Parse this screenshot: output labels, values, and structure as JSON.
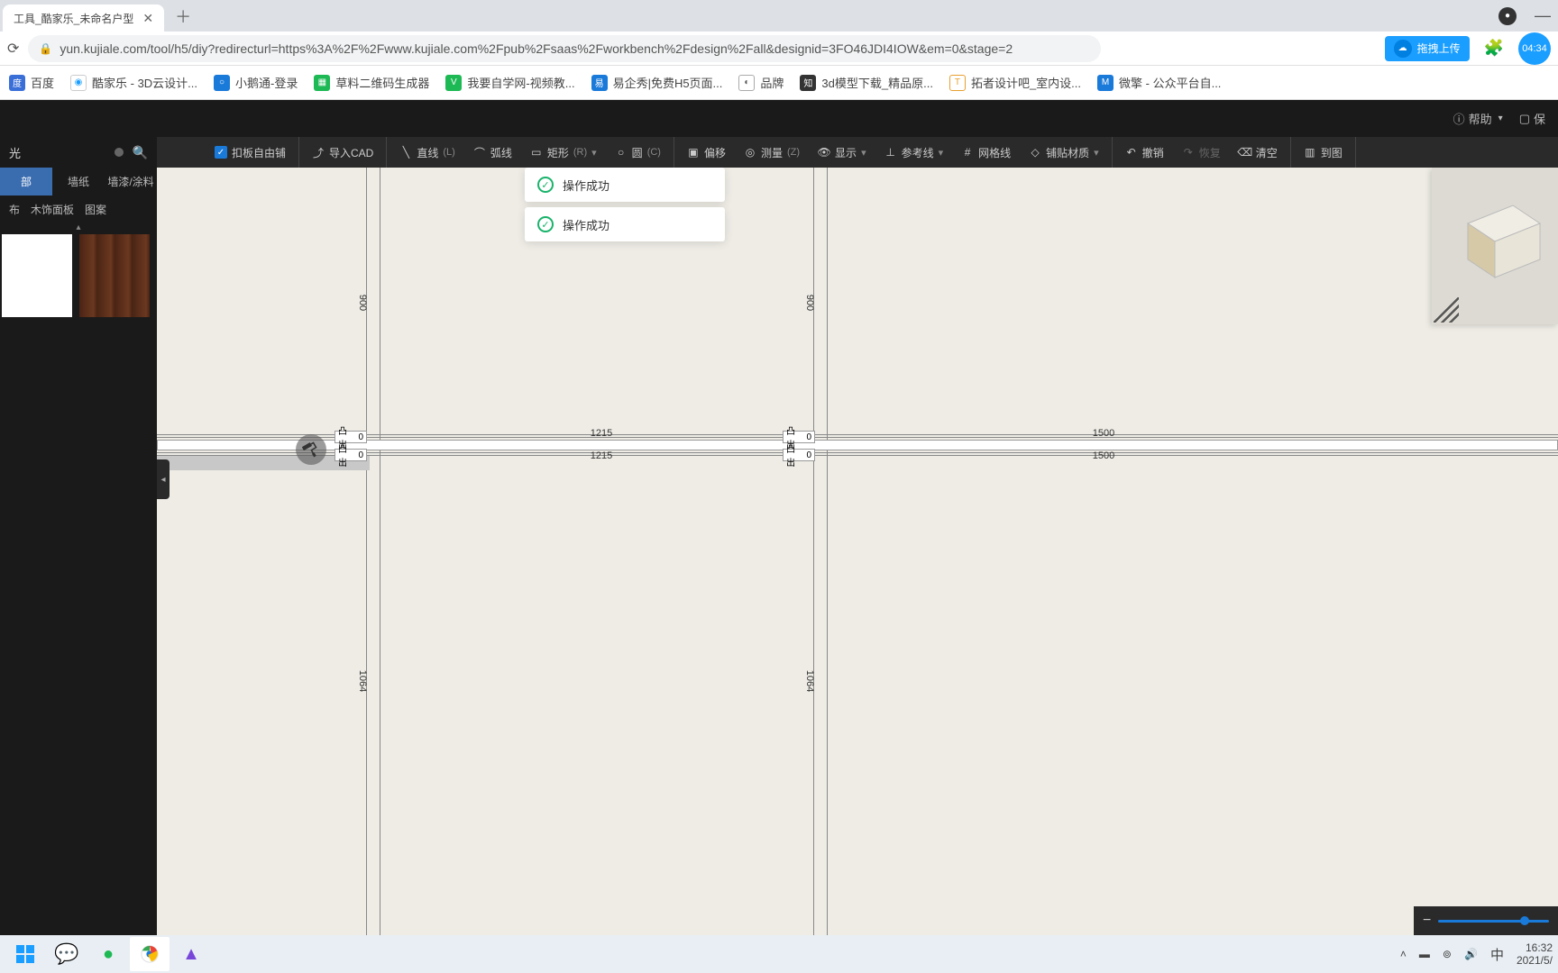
{
  "browser": {
    "tab_title": "工具_酷家乐_未命名户型",
    "url": "yun.kujiale.com/tool/h5/diy?redirecturl=https%3A%2F%2Fwww.kujiale.com%2Fpub%2Fsaas%2Fworkbench%2Fdesign%2Fall&designid=3FO46JDI4IOW&em=0&stage=2",
    "drag_upload": "拖拽上传",
    "timer": "04:34"
  },
  "bookmarks": [
    {
      "label": "百度",
      "color": "#3b6fd8"
    },
    {
      "label": "酷家乐 - 3D云设计...",
      "color": "#fff"
    },
    {
      "label": "小鹅通-登录",
      "color": "#1a7ad9"
    },
    {
      "label": "草料二维码生成器",
      "color": "#1db954"
    },
    {
      "label": "我要自学网-视频教...",
      "color": "#1db954"
    },
    {
      "label": "易企秀|免费H5页面...",
      "color": "#1a7ad9"
    },
    {
      "label": "品牌",
      "color": "#555"
    },
    {
      "label": "3d模型下载_精品原...",
      "color": "#333"
    },
    {
      "label": "拓者设计吧_室内设...",
      "color": "#e8a030"
    },
    {
      "label": "微擎 - 公众平台自...",
      "color": "#1a7ad9"
    }
  ],
  "header": {
    "help": "帮助",
    "save": "保"
  },
  "sidebar": {
    "title": "光",
    "tabs": [
      "部",
      "墙纸",
      "墙漆/涂料"
    ],
    "subs": [
      "布",
      "木饰面板",
      "图案"
    ]
  },
  "toolbar": {
    "snap": "扣板自由铺",
    "import_cad": "导入CAD",
    "line": "直线",
    "line_key": "(L)",
    "arc": "弧线",
    "rect": "矩形",
    "rect_key": "(R)",
    "circle": "圆",
    "circle_key": "(C)",
    "offset": "偏移",
    "measure": "测量",
    "measure_key": "(Z)",
    "display": "显示",
    "ref": "参考线",
    "grid": "网格线",
    "material": "铺贴材质",
    "undo": "撤销",
    "redo": "恢复",
    "clear": "清空",
    "to_view": "到图"
  },
  "toast": {
    "msg": "操作成功"
  },
  "dimensions": {
    "v_upper": "900",
    "v_lower": "1064",
    "h_seg1": "1215",
    "h_seg2": "1500",
    "offset_label": "凸出",
    "offset_val": "0"
  },
  "tray": {
    "ime": "中",
    "time": "16:32",
    "date": "2021/5/"
  }
}
